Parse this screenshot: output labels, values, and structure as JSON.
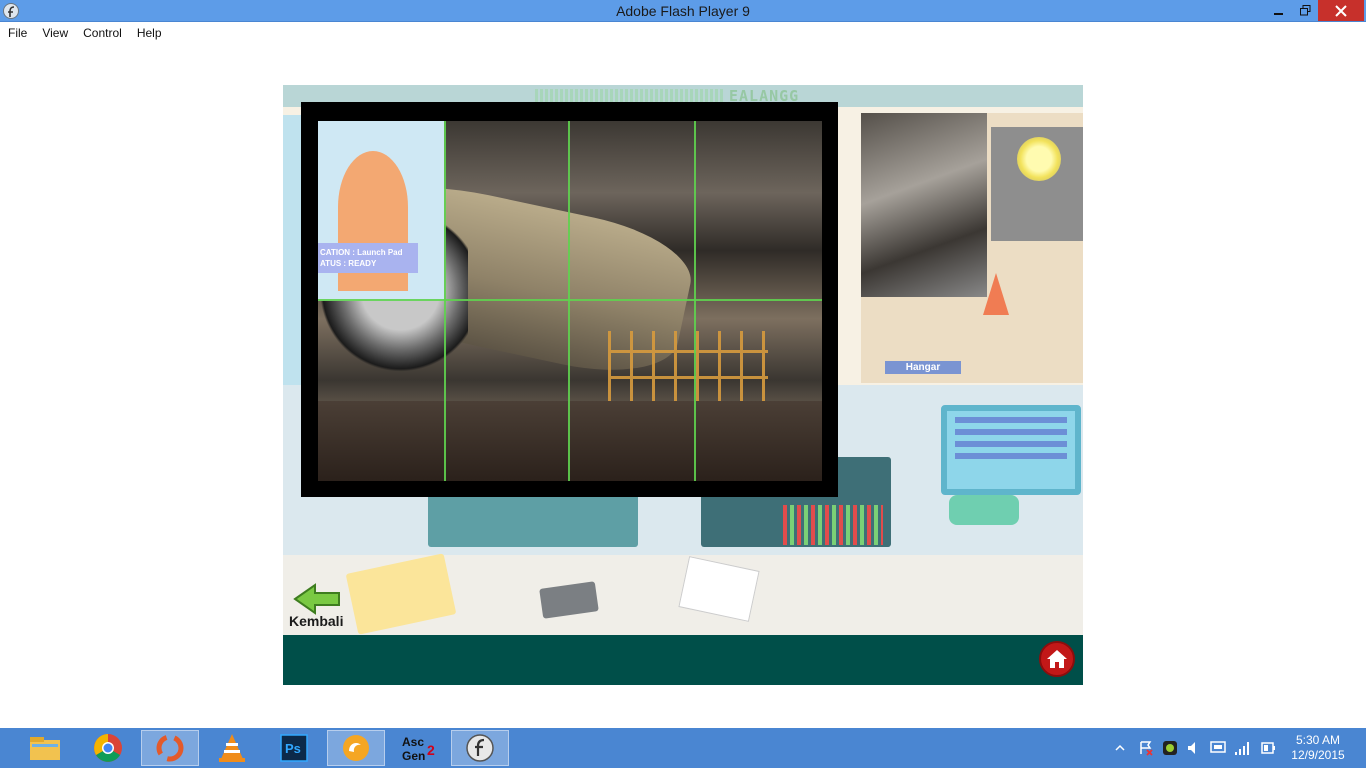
{
  "window": {
    "title": "Adobe Flash Player 9",
    "close_color": "#c7302b",
    "titlebar_color": "#5d9ce8"
  },
  "menu": {
    "items": [
      "File",
      "View",
      "Control",
      "Help"
    ]
  },
  "stage": {
    "header_text": "EALANGG",
    "hangar_label": "Hangar",
    "info_line1": "CATION  : Launch Pad",
    "info_line2": "ATUS      : READY",
    "back_label": "Kembali",
    "bottom_bar_color": "#004f49",
    "home_icon": "home-icon"
  },
  "taskbar": {
    "apps": [
      {
        "name": "file-explorer-icon"
      },
      {
        "name": "chrome-icon"
      },
      {
        "name": "app-ring-icon"
      },
      {
        "name": "vlc-icon"
      },
      {
        "name": "photoshop-icon",
        "label": "Ps"
      },
      {
        "name": "uc-browser-icon"
      },
      {
        "name": "ascgen-icon",
        "label": "Asc Gen2"
      },
      {
        "name": "flash-player-icon"
      }
    ],
    "time": "5:30 AM",
    "date": "12/9/2015"
  }
}
